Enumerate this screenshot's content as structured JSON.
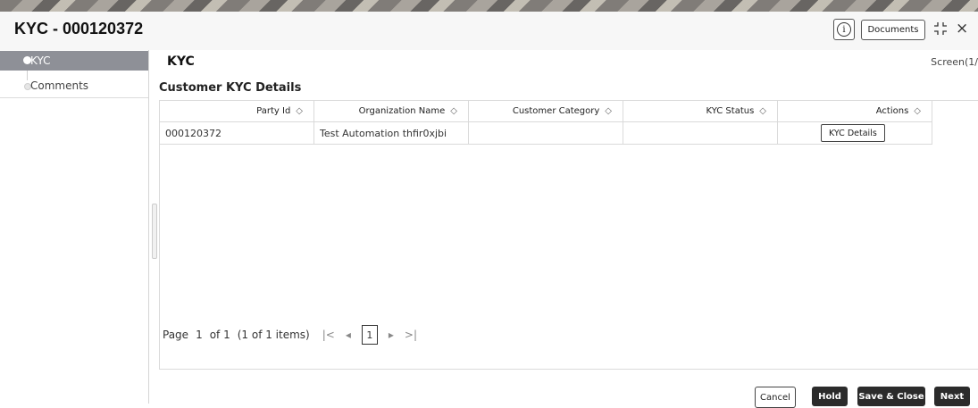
{
  "header": {
    "title": "KYC - 000120372",
    "info_icon_glyph": "i",
    "documents_label": "Documents",
    "close_glyph": "×"
  },
  "sidebar": {
    "items": [
      {
        "label": "KYC",
        "active": true
      },
      {
        "label": "Comments",
        "active": false
      }
    ]
  },
  "main": {
    "section_title": "KYC",
    "screen_indicator": "Screen(1/",
    "subsection_title": "Customer KYC Details",
    "table": {
      "columns": [
        "Party Id",
        "Organization Name",
        "Customer Category",
        "KYC Status",
        "Actions"
      ],
      "rows": [
        {
          "party_id": "000120372",
          "organization_name": "Test Automation thfir0xjbi",
          "customer_category": "",
          "kyc_status": "",
          "action_label": "KYC Details"
        }
      ]
    },
    "pagination": {
      "page_label": "Page",
      "current_page": "1",
      "of_label": "of 1",
      "items_label": "(1 of 1 items)",
      "first_glyph": "|<",
      "prev_glyph": "◂",
      "next_glyph": "▸",
      "last_glyph": ">|"
    }
  },
  "footer": {
    "cancel_label": "Cancel",
    "hold_label": "Hold",
    "save_close_label": "Save & Close",
    "next_label": "Next"
  },
  "colors": {
    "sidebar_active_bg": "#8e9097",
    "primary_button_bg": "#2b2b2b"
  }
}
